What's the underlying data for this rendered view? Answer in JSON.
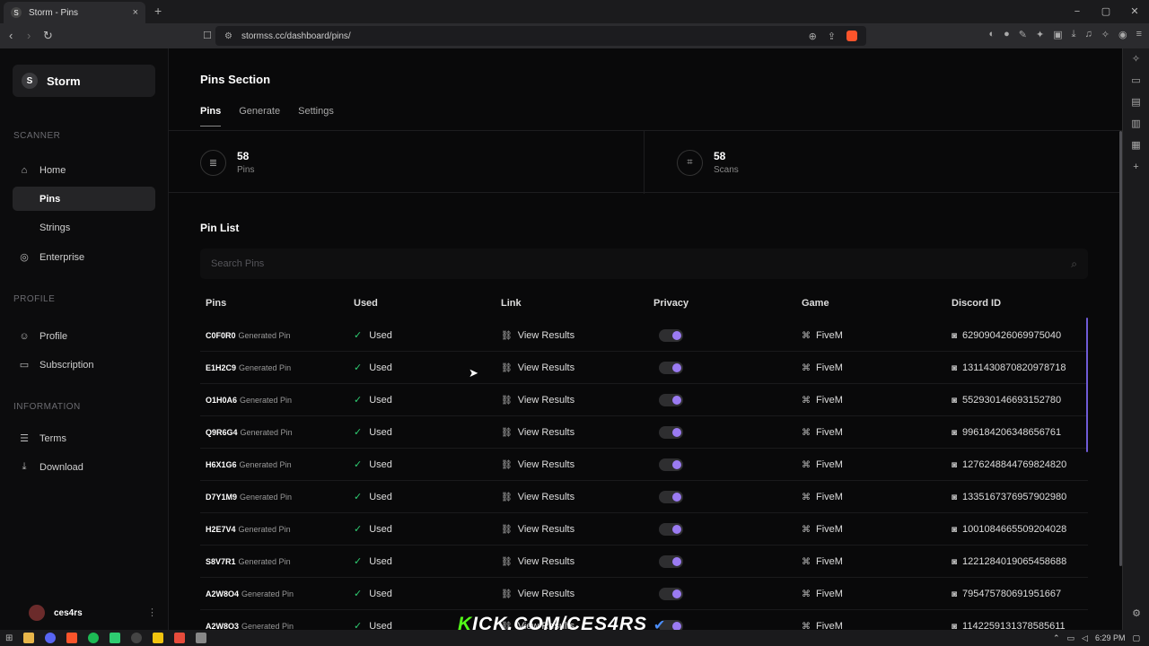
{
  "browser": {
    "tab_title": "Storm - Pins",
    "tab_close": "×",
    "new_tab": "+",
    "url": "stormss.cc/dashboard/pins/",
    "win_min": "−",
    "win_max": "▢",
    "win_close": "✕"
  },
  "sidebar": {
    "brand": "Storm",
    "sections": {
      "scanner": "SCANNER",
      "profile": "PROFILE",
      "information": "INFORMATION"
    },
    "items": {
      "home": "Home",
      "pins": "Pins",
      "strings": "Strings",
      "enterprise": "Enterprise",
      "profile": "Profile",
      "subscription": "Subscription",
      "terms": "Terms",
      "download": "Download"
    },
    "user": "ces4rs"
  },
  "main": {
    "title": "Pins Section",
    "tabs": [
      "Pins",
      "Generate",
      "Settings"
    ],
    "stats": [
      {
        "value": "58",
        "label": "Pins"
      },
      {
        "value": "58",
        "label": "Scans"
      }
    ],
    "list_title": "Pin List",
    "search_placeholder": "Search Pins",
    "columns": [
      "Pins",
      "Used",
      "Link",
      "Privacy",
      "Game",
      "Discord ID"
    ],
    "rows": [
      {
        "pin": "C0F0R0",
        "type": "Generated Pin",
        "used": "Used",
        "link": "View Results",
        "game": "FiveM",
        "discord": "629090426069975040"
      },
      {
        "pin": "E1H2C9",
        "type": "Generated Pin",
        "used": "Used",
        "link": "View Results",
        "game": "FiveM",
        "discord": "1311430870820978718"
      },
      {
        "pin": "O1H0A6",
        "type": "Generated Pin",
        "used": "Used",
        "link": "View Results",
        "game": "FiveM",
        "discord": "552930146693152780"
      },
      {
        "pin": "Q9R6G4",
        "type": "Generated Pin",
        "used": "Used",
        "link": "View Results",
        "game": "FiveM",
        "discord": "996184206348656761"
      },
      {
        "pin": "H6X1G6",
        "type": "Generated Pin",
        "used": "Used",
        "link": "View Results",
        "game": "FiveM",
        "discord": "1276248844769824820"
      },
      {
        "pin": "D7Y1M9",
        "type": "Generated Pin",
        "used": "Used",
        "link": "View Results",
        "game": "FiveM",
        "discord": "1335167376957902980"
      },
      {
        "pin": "H2E7V4",
        "type": "Generated Pin",
        "used": "Used",
        "link": "View Results",
        "game": "FiveM",
        "discord": "1001084665509204028"
      },
      {
        "pin": "S8V7R1",
        "type": "Generated Pin",
        "used": "Used",
        "link": "View Results",
        "game": "FiveM",
        "discord": "1221284019065458688"
      },
      {
        "pin": "A2W8O4",
        "type": "Generated Pin",
        "used": "Used",
        "link": "View Results",
        "game": "FiveM",
        "discord": "795475780691951667"
      },
      {
        "pin": "A2W8O3",
        "type": "Generated Pin",
        "used": "Used",
        "link": "View Results",
        "game": "FiveM",
        "discord": "1142259131378585611"
      }
    ]
  },
  "overlay": {
    "watermark_k": "K",
    "watermark_rest": "ICK.COM/CES4RS"
  },
  "taskbar": {
    "time": "6:29 PM"
  },
  "colors": {
    "accent": "#9b7bf2",
    "check": "#2ecc71",
    "kick": "#53fc18"
  }
}
